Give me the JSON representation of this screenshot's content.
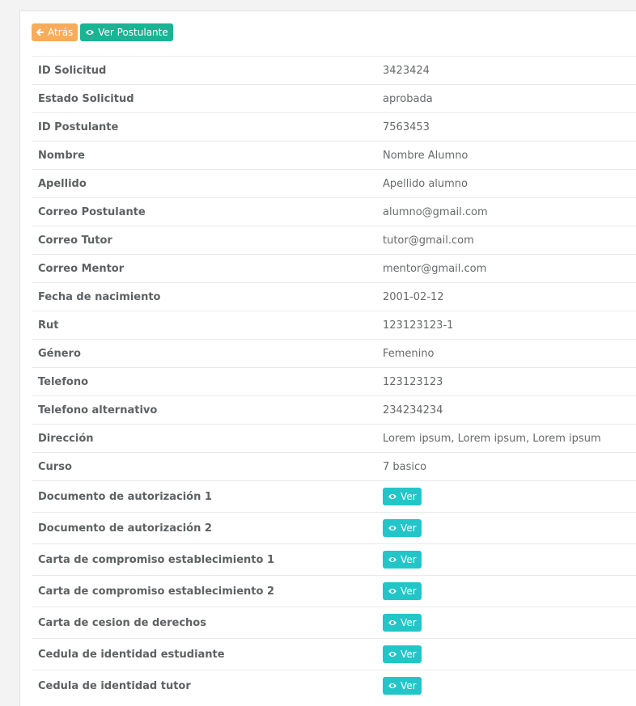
{
  "toolbar": {
    "back_label": "Atrás",
    "view_applicant_label": "Ver Postulante"
  },
  "details": [
    {
      "label": "ID Solicitud",
      "value": "3423424"
    },
    {
      "label": "Estado Solicitud",
      "value": "aprobada"
    },
    {
      "label": "ID Postulante",
      "value": "7563453"
    },
    {
      "label": "Nombre",
      "value": "Nombre Alumno"
    },
    {
      "label": "Apellido",
      "value": "Apellido alumno"
    },
    {
      "label": "Correo Postulante",
      "value": "alumno@gmail.com"
    },
    {
      "label": "Correo Tutor",
      "value": "tutor@gmail.com"
    },
    {
      "label": "Correo Mentor",
      "value": "mentor@gmail.com"
    },
    {
      "label": "Fecha de nacimiento",
      "value": "2001-02-12"
    },
    {
      "label": "Rut",
      "value": "123123123-1"
    },
    {
      "label": "Género",
      "value": "Femenino"
    },
    {
      "label": "Telefono",
      "value": "123123123"
    },
    {
      "label": "Telefono alternativo",
      "value": "234234234"
    },
    {
      "label": "Dirección",
      "value": "Lorem ipsum, Lorem ipsum, Lorem ipsum"
    },
    {
      "label": "Curso",
      "value": "7 basico"
    }
  ],
  "documents": [
    {
      "label": "Documento de autorización 1",
      "button": "Ver"
    },
    {
      "label": "Documento de autorización 2",
      "button": "Ver"
    },
    {
      "label": "Carta de compromiso establecimiento 1",
      "button": "Ver"
    },
    {
      "label": "Carta de compromiso establecimiento 2",
      "button": "Ver"
    },
    {
      "label": "Carta de cesion de derechos",
      "button": "Ver"
    },
    {
      "label": "Cedula de identidad estudiante",
      "button": "Ver"
    },
    {
      "label": "Cedula de identidad tutor",
      "button": "Ver"
    }
  ],
  "icons": {
    "back": "arrow-left-icon",
    "view": "eye-icon"
  },
  "colors": {
    "warning": "#f8ac59",
    "primary": "#1ab394",
    "info": "#23c6c8"
  }
}
